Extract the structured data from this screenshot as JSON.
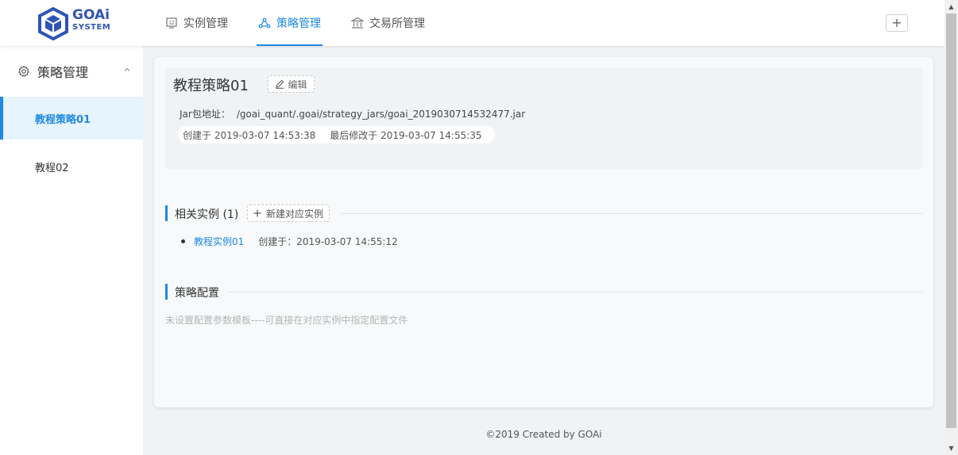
{
  "brand": {
    "name_top": "GOAi",
    "name_bottom": "SYSTEM",
    "color": "#2f54b5"
  },
  "nav": {
    "items": [
      {
        "label": "实例管理",
        "icon": "monitor-icon",
        "active": false
      },
      {
        "label": "策略管理",
        "icon": "cluster-icon",
        "active": true
      },
      {
        "label": "交易所管理",
        "icon": "bank-icon",
        "active": false
      }
    ],
    "add_label": "+"
  },
  "sidebar": {
    "group_label": "策略管理",
    "items": [
      {
        "label": "教程策略01",
        "active": true
      },
      {
        "label": "教程02",
        "active": false
      }
    ]
  },
  "strategy": {
    "title": "教程策略01",
    "edit_label": "编辑",
    "jar_label": "Jar包地址：",
    "jar_path": "/goai_quant/.goai/strategy_jars/goai_2019030714532477.jar",
    "created": "创建于 2019-03-07 14:53:38",
    "modified": "最后修改于 2019-03-07 14:55:35"
  },
  "instances_section": {
    "title": "相关实例 (1)",
    "new_label": "新建对应实例",
    "items": [
      {
        "name": "教程实例01",
        "created": "创建于：2019-03-07 14:55:12"
      }
    ]
  },
  "config_section": {
    "title": "策略配置",
    "empty_text": "未设置配置参数模板----可直接在对应实例中指定配置文件"
  },
  "footer": {
    "text": "©2019 Created by GOAi"
  },
  "colors": {
    "accent": "#1e88e5",
    "active_bg": "#e6f4fd",
    "page_bg": "#f0f2f5"
  }
}
